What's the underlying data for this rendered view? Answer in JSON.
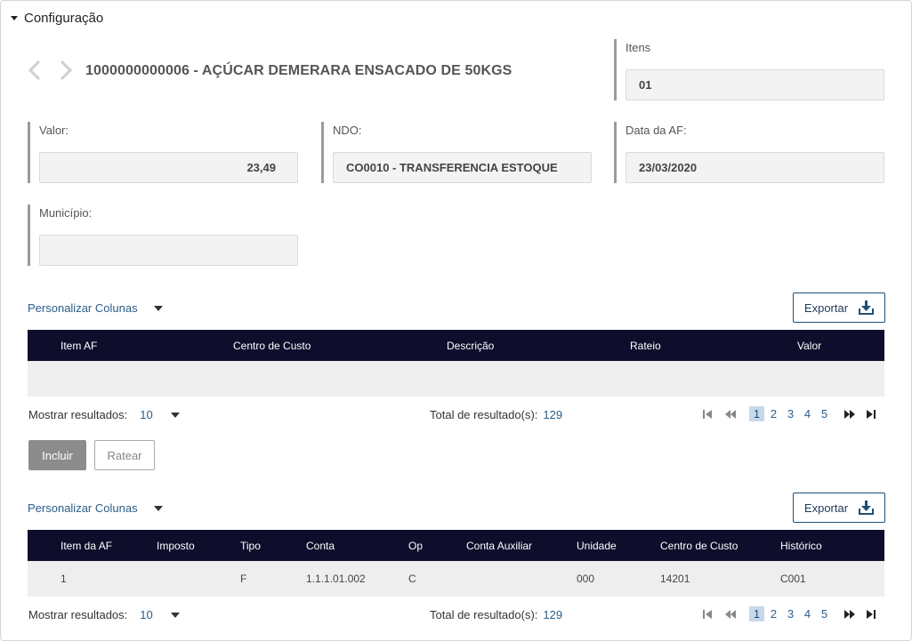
{
  "section": {
    "title": "Configuração"
  },
  "product": {
    "title": "1000000000006 - AÇÚCAR DEMERARA ENSACADO DE 50KGS"
  },
  "fields": {
    "itens": {
      "label": "Itens",
      "value": "01"
    },
    "valor": {
      "label": "Valor:",
      "value": "23,49"
    },
    "ndo": {
      "label": "NDO:",
      "value": "CO0010 - TRANSFERENCIA ESTOQUE"
    },
    "data_af": {
      "label": "Data da AF:",
      "value": "23/03/2020"
    },
    "municipio": {
      "label": "Município:",
      "value": ""
    }
  },
  "table1": {
    "customize_label": "Personalizar Colunas",
    "export_label": "Exportar",
    "columns": [
      "Item AF",
      "Centro de Custo",
      "Descrição",
      "Rateio",
      "Valor"
    ],
    "footer": {
      "show_label": "Mostrar resultados:",
      "show_value": "10",
      "total_label": "Total de resultado(s):",
      "total_value": "129",
      "pages": [
        "1",
        "2",
        "3",
        "4",
        "5"
      ],
      "active_page": "1"
    }
  },
  "buttons": {
    "incluir": "Incluir",
    "ratear": "Ratear"
  },
  "table2": {
    "customize_label": "Personalizar Colunas",
    "export_label": "Exportar",
    "columns": [
      "Item da AF",
      "Imposto",
      "Tipo",
      "Conta",
      "Op",
      "Conta Auxiliar",
      "Unidade",
      "Centro de Custo",
      "Histórico"
    ],
    "rows": [
      [
        "1",
        "",
        "F",
        "1.1.1.01.002",
        "C",
        "",
        "000",
        "14201",
        "C001"
      ]
    ],
    "footer": {
      "show_label": "Mostrar resultados:",
      "show_value": "10",
      "total_label": "Total de resultado(s):",
      "total_value": "129",
      "pages": [
        "1",
        "2",
        "3",
        "4",
        "5"
      ],
      "active_page": "1"
    }
  },
  "colors": {
    "header_bg": "#0e0e2c",
    "link": "#2a5d8a",
    "field_bg": "#f3f3f3",
    "active_page_bg": "#c7d8ea",
    "incluir_bg": "#8c8c8c"
  },
  "icons": {
    "section_toggle": "caret-down-icon",
    "prev": "chevron-left-icon",
    "next": "chevron-right-icon",
    "export": "download-icon",
    "pager": [
      "first-page-icon",
      "prev-page-icon",
      "next-page-icon",
      "last-page-icon"
    ]
  }
}
